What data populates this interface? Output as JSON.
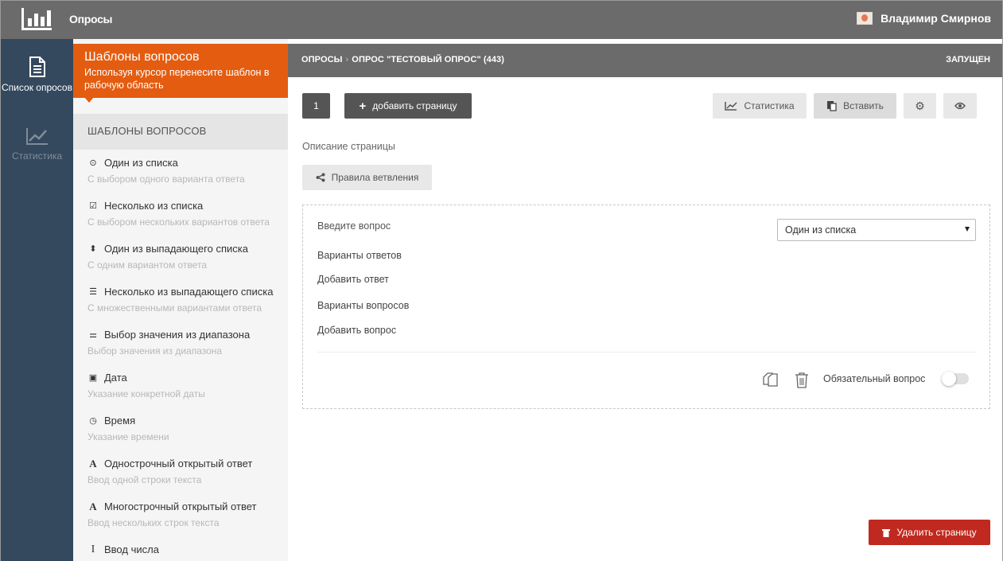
{
  "app": {
    "title": "Опросы"
  },
  "user": {
    "name": "Владимир Смирнов"
  },
  "left_nav": {
    "items": [
      {
        "label": "Список опросов",
        "icon": "document-icon",
        "active": true
      },
      {
        "label": "Статистика",
        "icon": "chart-icon",
        "active": false
      }
    ]
  },
  "templates": {
    "header_title": "Шаблоны вопросов",
    "header_hint": "Используя курсор перенесите шаблон в рабочую область",
    "section_title": "ШАБЛОНЫ ВОПРОСОВ",
    "items": [
      {
        "title": "Один из списка",
        "desc": "С выбором одного варианта ответа",
        "icon": "radio-icon"
      },
      {
        "title": "Несколько из списка",
        "desc": "С выбором нескольких вариантов ответа",
        "icon": "checkbox-icon"
      },
      {
        "title": "Один из выпадающего списка",
        "desc": "С одним вариантом ответа",
        "icon": "sort-icon"
      },
      {
        "title": "Несколько из выпадающего списка",
        "desc": "С множественными вариантами ответа",
        "icon": "list-icon"
      },
      {
        "title": "Выбор значения из диапазона",
        "desc": "Выбор значения из диапазона",
        "icon": "sliders-icon"
      },
      {
        "title": "Дата",
        "desc": "Указание конкретной даты",
        "icon": "calendar-icon"
      },
      {
        "title": "Время",
        "desc": "Указание времени",
        "icon": "clock-icon"
      },
      {
        "title": "Однострочный открытый ответ",
        "desc": "Ввод одной строки текста",
        "icon": "text-icon"
      },
      {
        "title": "Многострочный открытый ответ",
        "desc": "Ввод нескольких строк текста",
        "icon": "text-icon"
      },
      {
        "title": "Ввод числа",
        "desc": "",
        "icon": "text-cursor-icon"
      }
    ]
  },
  "breadcrumb": {
    "root": "ОПРОСЫ",
    "current": "ОПРОС \"ТЕСТОВЫЙ ОПРОС\" (443)",
    "status": "ЗАПУЩЕН"
  },
  "toolbar": {
    "page_number": "1",
    "add_page_label": "добавить страницу",
    "statistics_label": "Статистика",
    "paste_label": "Вставить"
  },
  "page": {
    "description_label": "Описание страницы",
    "branching_label": "Правила ветвления"
  },
  "question": {
    "placeholder": "Введите вопрос",
    "type_value": "Один из списка",
    "answers_label": "Варианты ответов",
    "add_answer_label": "Добавить ответ",
    "variants_label": "Варианты вопросов",
    "add_variant_label": "Добавить вопрос",
    "required_label": "Обязательный вопрос",
    "required": false
  },
  "delete_page_label": "Удалить страницу",
  "colors": {
    "accent": "#e45c10",
    "nav": "#34495e",
    "topbar": "#6b6b6b",
    "danger": "#c0291f"
  }
}
